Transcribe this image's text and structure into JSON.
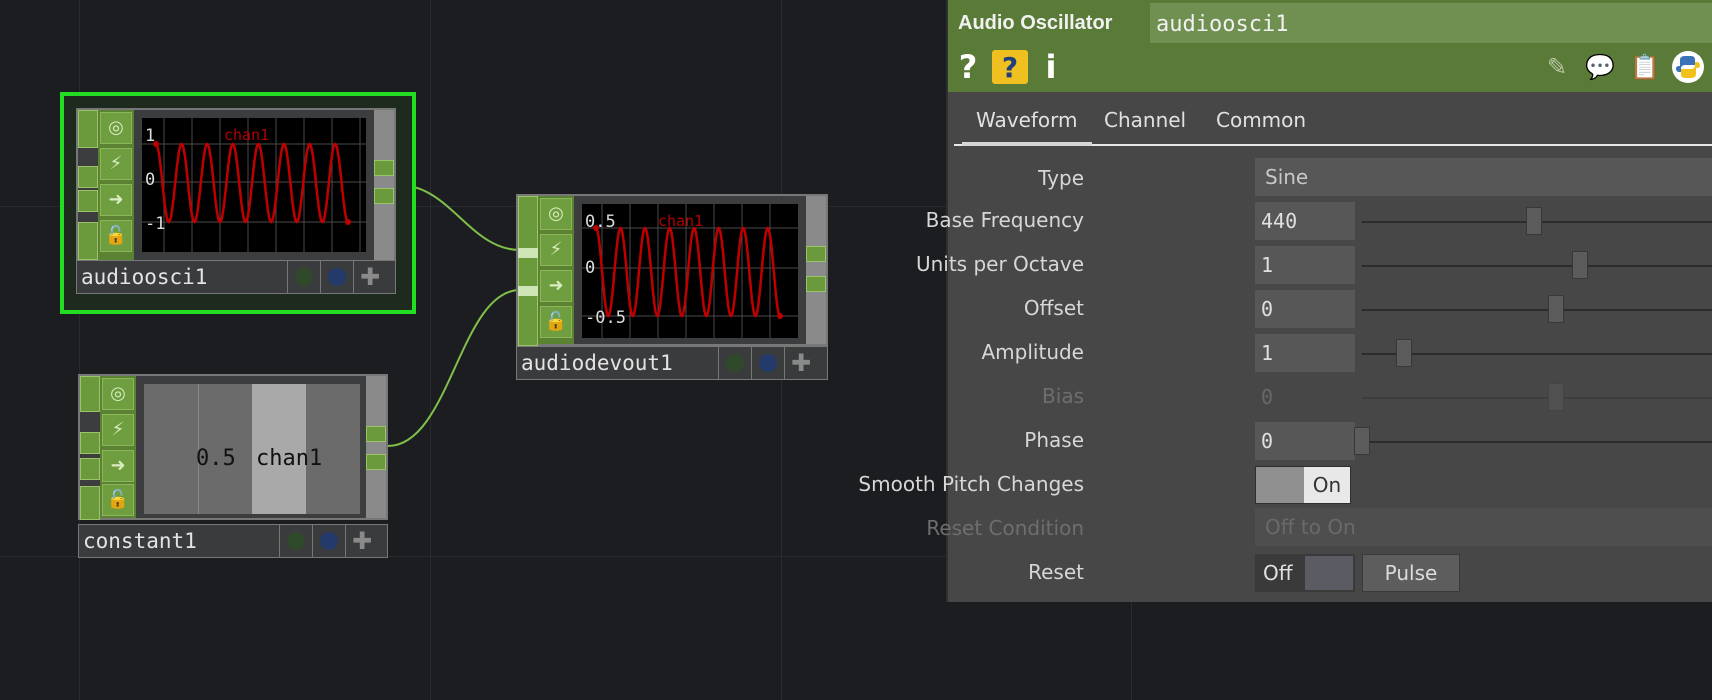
{
  "network": {
    "nodes": {
      "audioosci1": {
        "name": "audioosci1",
        "viewer": {
          "top_value": "1",
          "mid_value": "0",
          "bottom_value": "-1",
          "channel": "chan1"
        }
      },
      "audiodevout1": {
        "name": "audiodevout1",
        "viewer": {
          "top_value": "0.5",
          "mid_value": "0",
          "bottom_value": "-0.5",
          "channel": "chan1"
        }
      },
      "constant1": {
        "name": "constant1",
        "viewer": {
          "value": "0.5",
          "channel": "chan1"
        }
      }
    }
  },
  "panel": {
    "op_type": "Audio Oscillator",
    "op_name": "audioosci1",
    "header_icons": [
      "help-icon",
      "python-help-icon",
      "info-icon",
      "edit-icon",
      "comment-icon",
      "clipboard-icon",
      "python-icon"
    ],
    "tabs": [
      "Waveform",
      "Channel",
      "Common"
    ],
    "active_tab": "Waveform",
    "params": {
      "type": {
        "label": "Type",
        "value": "Sine"
      },
      "base_frequency": {
        "label": "Base Frequency",
        "value": "440",
        "slider_fraction": 0.49
      },
      "units_per_octave": {
        "label": "Units per Octave",
        "value": "1",
        "slider_fraction": 0.62
      },
      "offset": {
        "label": "Offset",
        "value": "0",
        "slider_fraction": 0.55
      },
      "amplitude": {
        "label": "Amplitude",
        "value": "1",
        "slider_fraction": 0.12
      },
      "bias": {
        "label": "Bias",
        "value": "0",
        "slider_fraction": 0.55,
        "disabled": true
      },
      "phase": {
        "label": "Phase",
        "value": "0",
        "slider_fraction": 0.0
      },
      "smooth_pitch_changes": {
        "label": "Smooth Pitch Changes",
        "value": "On"
      },
      "reset_condition": {
        "label": "Reset Condition",
        "value": "Off to On",
        "disabled": true
      },
      "reset": {
        "label": "Reset",
        "value": "Off",
        "button": "Pulse"
      }
    }
  },
  "colors": {
    "selection": "#22dd22",
    "node_green": "#6b9a3c",
    "wave": "#c00000",
    "header_green": "#5a7a38",
    "wire": "#7fbf4a"
  }
}
